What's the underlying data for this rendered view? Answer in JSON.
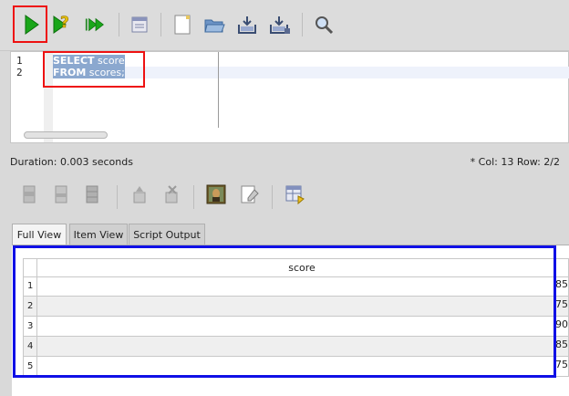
{
  "toolbar": {
    "buttons": [
      {
        "name": "execute-icon"
      },
      {
        "name": "explain-icon"
      },
      {
        "name": "execute-all-icon"
      },
      {
        "name": "find-replace-icon"
      },
      {
        "name": "new-file-icon"
      },
      {
        "name": "open-folder-icon"
      },
      {
        "name": "save-icon"
      },
      {
        "name": "save-as-icon"
      },
      {
        "name": "find-icon"
      }
    ]
  },
  "editor": {
    "line_numbers": [
      "1",
      "2"
    ],
    "lines": [
      {
        "keyword": "SELECT",
        "rest": " score"
      },
      {
        "keyword": "FROM",
        "rest": " scores;"
      }
    ]
  },
  "status": {
    "duration": "Duration: 0.003 seconds",
    "position": "*  Col: 13 Row: 2/2"
  },
  "tabs": [
    {
      "label": "Full View",
      "active": true
    },
    {
      "label": "Item View",
      "active": false
    },
    {
      "label": "Script Output",
      "active": false
    }
  ],
  "results": {
    "columns": [
      "score"
    ],
    "rows": [
      {
        "num": "1",
        "value": "85"
      },
      {
        "num": "2",
        "value": "75"
      },
      {
        "num": "3",
        "value": "90"
      },
      {
        "num": "4",
        "value": "85"
      },
      {
        "num": "5",
        "value": "75"
      }
    ]
  },
  "colors": {
    "highlight_red": "#e11111",
    "highlight_blue": "#1010e6",
    "selection": "#8ba8cf"
  }
}
